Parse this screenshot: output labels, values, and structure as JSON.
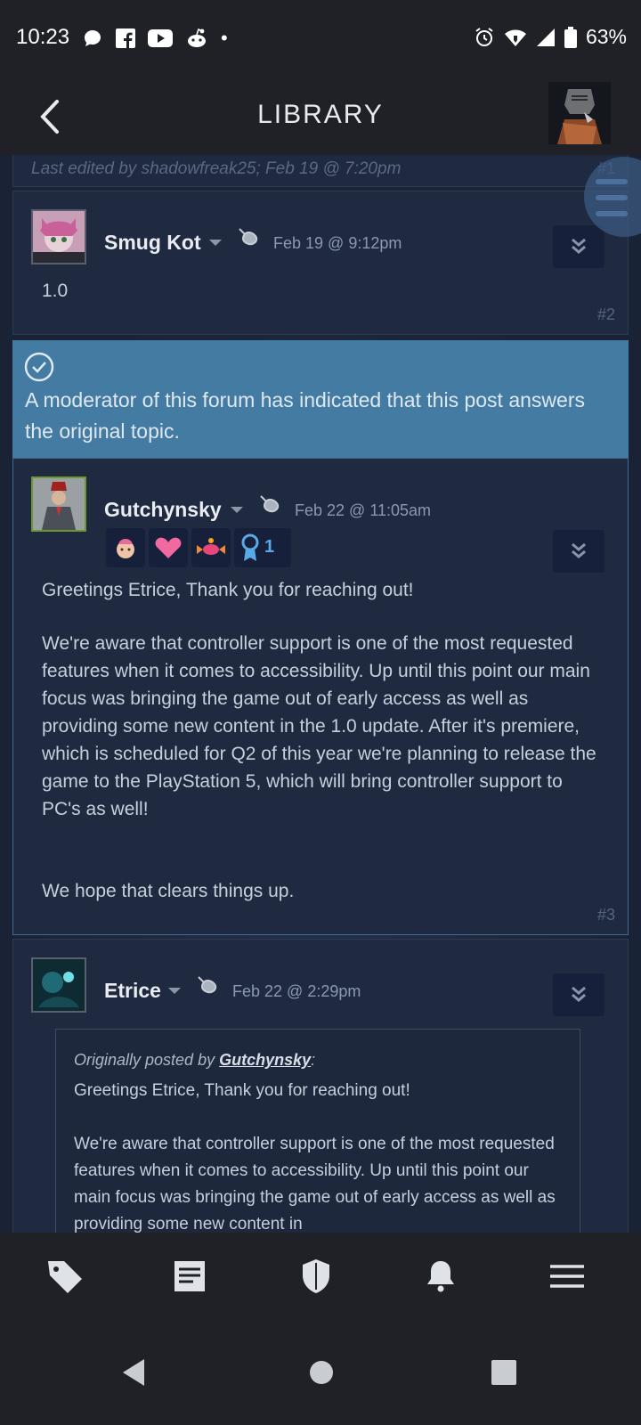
{
  "status": {
    "time": "10:23",
    "battery": "63%",
    "dot": "•"
  },
  "app": {
    "title": "LIBRARY"
  },
  "posts": [
    {
      "edited_prefix": "Last edited by ",
      "edited_by": "shadowfreak25",
      "edited_when": "; Feb 19 @ 7:20pm",
      "num": "#1"
    },
    {
      "user": "Smug Kot",
      "date": "Feb 19 @ 9:12pm",
      "body": "1.0",
      "num": "#2"
    },
    {
      "user": "Gutchynsky",
      "date": "Feb 22 @ 11:05am",
      "badge_count": "1",
      "p1": "Greetings Etrice, Thank you for reaching out!",
      "p2": "We're aware that controller support is one of the most requested features when it comes to accessibility. Up until this point our main focus was bringing the game out of early access as well as providing some new content in the 1.0 update. After it's premiere, which is scheduled for Q2 of this year we're planning to release the game to the PlayStation 5, which will bring controller support to PC's as well!",
      "p3": "We hope that clears things up.",
      "num": "#3"
    },
    {
      "user": "Etrice",
      "date": "Feb 22 @ 2:29pm",
      "quote_prefix": "Originally posted by ",
      "quote_author": "Gutchynsky",
      "quote_suffix": ":",
      "q1": "Greetings Etrice, Thank you for reaching out!",
      "q2": "We're aware that controller support is one of the most requested features when it comes to accessibility. Up until this point our main focus was bringing the game out of early access as well as providing some new content in"
    }
  ],
  "moderator_notice": "A moderator of this forum has indicated that this post answers the original topic.",
  "colors": {
    "banner": "#447ba3",
    "background": "#1b2133",
    "bar": "#1f2127"
  }
}
